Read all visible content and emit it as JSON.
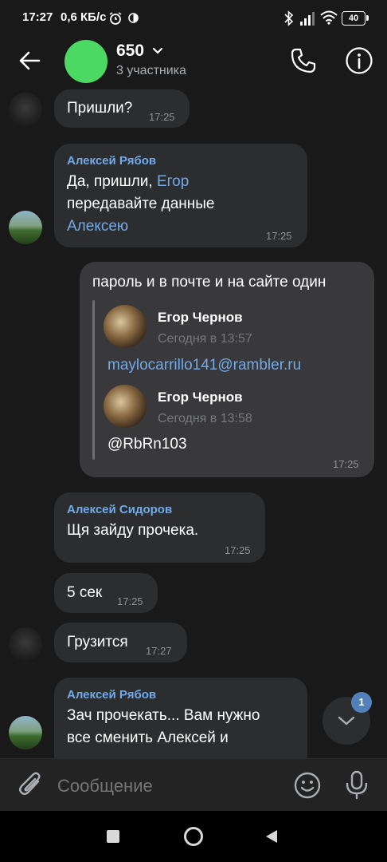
{
  "status_bar": {
    "time": "17:27",
    "speed": "0,6 КБ/с",
    "battery": "40",
    "icons": [
      "alarm-icon",
      "half-circle-icon",
      "bluetooth-icon",
      "signal-icon",
      "wifi-icon",
      "battery-icon"
    ]
  },
  "header": {
    "title": "650",
    "subtitle": "3 участника",
    "avatar_color": "#4bd863"
  },
  "messages": [
    {
      "text": "Пришли?",
      "time": "17:25"
    },
    {
      "sender": "Алексей Рябов",
      "text_1": "Да, пришли, ",
      "mention_1": "Егор",
      "text_2": "передавайте данные",
      "mention_2": "Алексею",
      "time": "17:25"
    },
    {
      "text": "пароль и в почте и на сайте один",
      "forwards": [
        {
          "author": "Егор Чернов",
          "date": "Сегодня в 13:57",
          "text": "maylocarrillo141@rambler.ru"
        },
        {
          "author": "Егор Чернов",
          "date": "Сегодня в 13:58",
          "text": "@RbRn103"
        }
      ],
      "time": "17:25"
    },
    {
      "sender": "Алексей Сидоров",
      "text": "Щя зайду прочека.",
      "time": "17:25"
    },
    {
      "text": "5 сек",
      "time": "17:25"
    },
    {
      "text": "Грузится",
      "time": "17:27"
    },
    {
      "sender": "Алексей Рябов",
      "text_1": "Зач прочекать... Вам нужно",
      "text_2": "все сменить Алексей и"
    }
  ],
  "scroll_badge": "1",
  "composer": {
    "placeholder": "Сообщение"
  },
  "colors": {
    "accent": "#71aaeb",
    "background": "#19191a",
    "bubble": "#2c2d2e",
    "badge": "#5181b8"
  }
}
